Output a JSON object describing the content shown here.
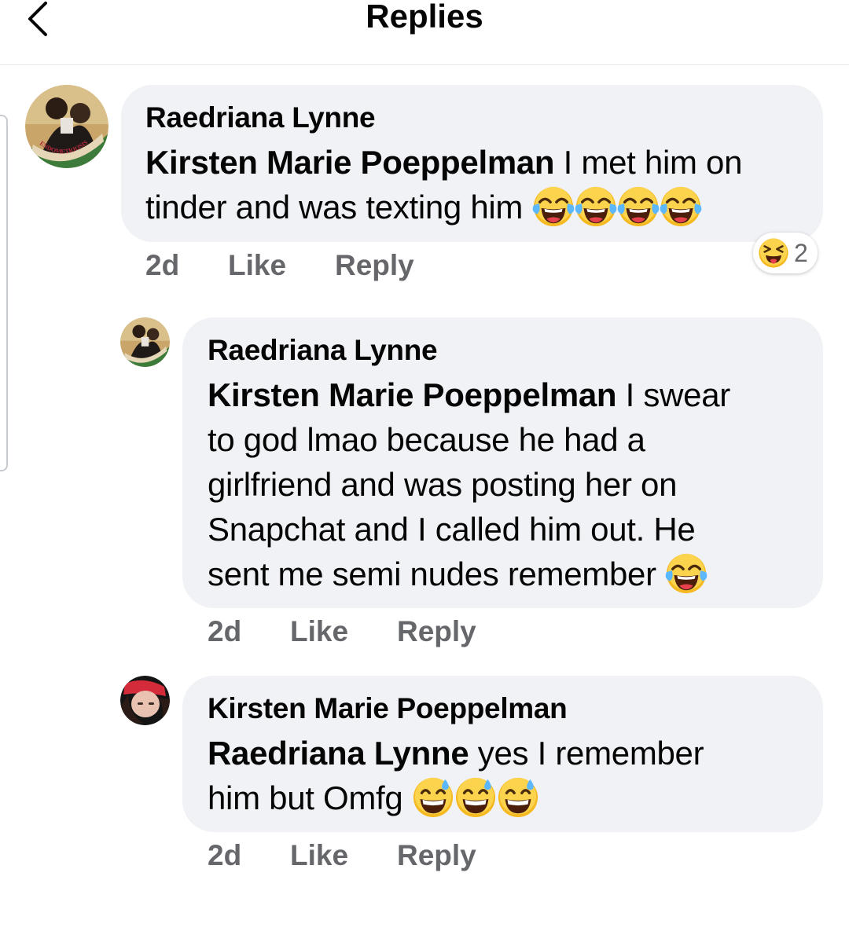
{
  "header": {
    "title": "Replies",
    "back_icon": "chevron-left-icon"
  },
  "avatar_badge_text": "ENDOMETRIOSIS",
  "comments": [
    {
      "author": "Raedriana Lynne",
      "mention": "Kirsten Marie Poeppelman",
      "text_line1": " I met him on",
      "text_line2": "tinder and was texting him",
      "emoji": "face-with-tears-of-joy-icon",
      "emoji_count": 4,
      "time": "2d",
      "like": "Like",
      "reply": "Reply",
      "reaction": {
        "icon": "squinting-face-with-tongue-icon",
        "count": "2"
      }
    },
    {
      "author": "Raedriana Lynne",
      "mention": "Kirsten Marie Poeppelman",
      "text_line1": " I swear",
      "text_line2": "to god lmao because he had a",
      "text_line3": "girlfriend and was posting her on",
      "text_line4": "Snapchat and I called him out. He",
      "text_line5": "sent me semi nudes remember",
      "emoji": "face-with-tears-of-joy-icon",
      "emoji_count": 1,
      "time": "2d",
      "like": "Like",
      "reply": "Reply"
    },
    {
      "author": "Kirsten Marie Poeppelman",
      "mention": "Raedriana Lynne",
      "text_line1": " yes I remember",
      "text_line2": "him but Omfg",
      "emoji": "grinning-face-with-sweat-icon",
      "emoji_count": 3,
      "time": "2d",
      "like": "Like",
      "reply": "Reply"
    }
  ],
  "colors": {
    "bubble": "#f0f2f5",
    "meta_text": "#65676b",
    "text": "#050505",
    "emoji_yellow": "#f7c02e"
  }
}
